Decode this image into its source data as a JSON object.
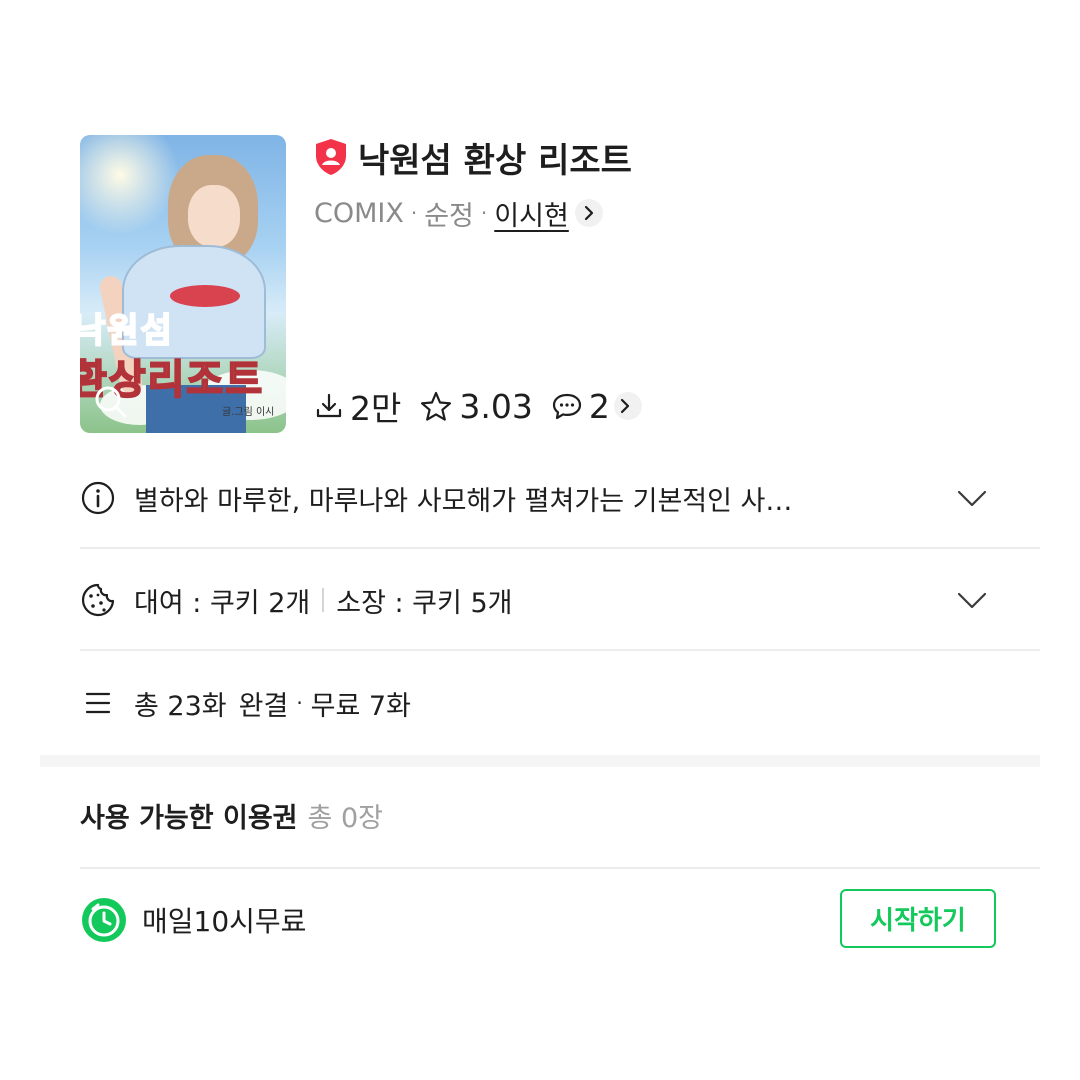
{
  "series": {
    "title": "낙원섬 환상 리조트",
    "category": "COMIX",
    "genre": "순정",
    "author": "이시현",
    "badge_icon": "adult-shield-icon",
    "cover_text_line1": "낙원섬",
    "cover_text_line2": "환상리조트",
    "cover_credit": "글.그림 이시"
  },
  "stats": {
    "downloads": "2만",
    "rating": "3.03",
    "comments": "2"
  },
  "info_rows": {
    "description": "별하와 마루한, 마루나와 사모해가 펼쳐가는 기본적인 사…",
    "price_rent": "대여 : 쿠키 2개",
    "price_own": "소장 : 쿠키 5개",
    "episodes_total": "총 23화",
    "episodes_status": "완결",
    "episodes_free": "무료 7화"
  },
  "vouchers": {
    "title": "사용 가능한 이용권",
    "count": "총 0장"
  },
  "daily_free": {
    "label": "매일10시무료",
    "button": "시작하기"
  },
  "colors": {
    "accent": "#14c95b",
    "badge": "#f2334a",
    "text": "#1e1e1e",
    "muted": "#8a8a8a"
  }
}
